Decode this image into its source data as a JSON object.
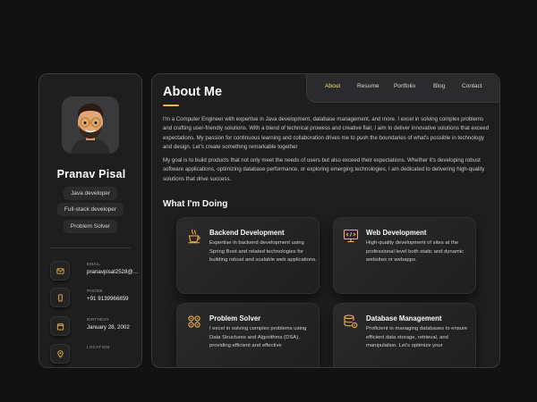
{
  "profile": {
    "name": "Pranav Pisal",
    "tags": [
      "Java developer",
      "Full-stack developer",
      "Problem Solver"
    ],
    "contacts": [
      {
        "label": "EMAIL",
        "value": "pranavpisal2528@...",
        "icon": "mail-icon"
      },
      {
        "label": "PHONE",
        "value": "+91 9139966859",
        "icon": "phone-icon"
      },
      {
        "label": "BIRTHDAY",
        "value": "January 28, 2002",
        "icon": "calendar-icon"
      },
      {
        "label": "LOCATION",
        "value": "",
        "icon": "location-icon"
      }
    ]
  },
  "nav": {
    "items": [
      "About",
      "Resume",
      "Portfolio",
      "Blog",
      "Contact"
    ],
    "active": "About"
  },
  "about": {
    "title": "About Me",
    "paragraphs": [
      "I'm a Computer Engineer with expertise in Java development, database management, and more. I excel in solving complex problems and crafting user-friendly solutions. With a blend of technical prowess and creative flair, I aim to deliver innovative solutions that exceed expectations. My passion for continuous learning and collaboration drives me to push the boundaries of what's possible in technology and design. Let's create something remarkable together",
      "My goal is to build products that not only meet the needs of users but also exceed their expectations. Whether it's developing robust software applications, optimizing database performance, or exploring emerging technologies, I am dedicated to delivering high-quality solutions that drive success."
    ]
  },
  "services": {
    "title": "What I'm Doing",
    "items": [
      {
        "title": "Backend Development",
        "icon": "coffee-java-icon",
        "desc": "Expertise in backend development using Spring Boot and related technologies for building robust and scalable web applications."
      },
      {
        "title": "Web Development",
        "icon": "code-monitor-icon",
        "desc": "High-quality development of sites at the professional level both static and dynamic websites or webapps."
      },
      {
        "title": "Problem Solver",
        "icon": "gears-brain-icon",
        "desc": "I excel in solving complex problems using Data Structures and Algorithms (DSA), providing efficient and effective"
      },
      {
        "title": "Database Management",
        "icon": "database-icon",
        "desc": "Proficient in managing databases to ensure efficient data storage, retrieval, and manipulation. Let's optimize your"
      }
    ]
  },
  "colors": {
    "accent": "#ffdb70",
    "accent_line": "#f5b14a",
    "background": "#121212",
    "panel": "#1e1e1f"
  }
}
